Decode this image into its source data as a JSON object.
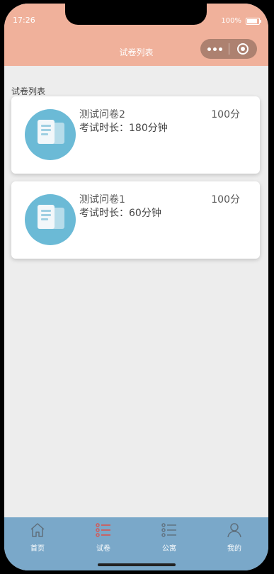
{
  "status": {
    "time": "17:26",
    "battery": "100%"
  },
  "nav": {
    "title": "试卷列表"
  },
  "section": {
    "title": "试卷列表"
  },
  "papers": [
    {
      "name": "测试问卷2",
      "score": "100分",
      "duration": "考试时长：180分钟"
    },
    {
      "name": "测试问卷1",
      "score": "100分",
      "duration": "考试时长：60分钟"
    }
  ],
  "tabs": [
    {
      "label": "首页",
      "icon": "home-icon"
    },
    {
      "label": "试卷",
      "icon": "list-icon",
      "active": true
    },
    {
      "label": "公寓",
      "icon": "list-outline-icon"
    },
    {
      "label": "我的",
      "icon": "user-icon"
    }
  ],
  "colors": {
    "header": "#f0b19b",
    "tabbar": "#7aa8c9",
    "active_tab_icon": "#d9534f",
    "card_icon_circle": "#6bbad6"
  }
}
